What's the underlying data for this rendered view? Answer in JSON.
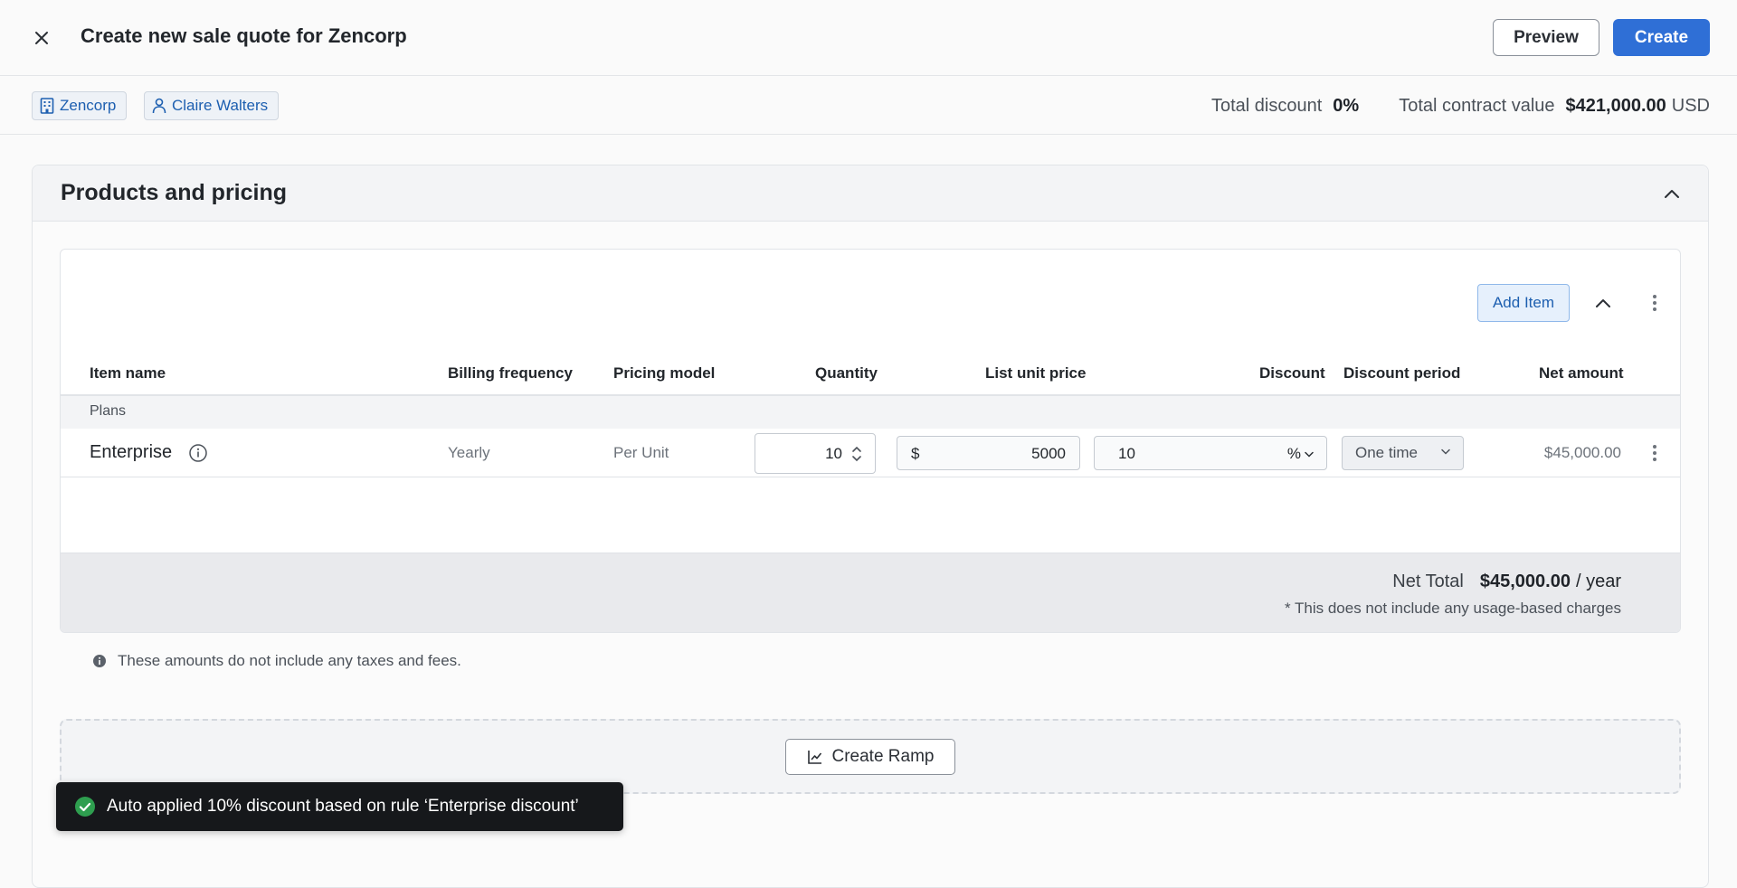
{
  "header": {
    "title": "Create new sale quote for Zencorp",
    "preview_label": "Preview",
    "create_label": "Create"
  },
  "subbar": {
    "company": "Zencorp",
    "contact": "Claire Walters",
    "total_discount_label": "Total discount",
    "total_discount_value": "0%",
    "total_contract_label": "Total contract value",
    "total_contract_value": "$421,000.00",
    "total_contract_currency": "USD"
  },
  "section": {
    "title": "Products and pricing"
  },
  "items": {
    "add_item_label": "Add Item",
    "columns": {
      "item_name": "Item name",
      "billing_frequency": "Billing frequency",
      "pricing_model": "Pricing model",
      "quantity": "Quantity",
      "list_unit_price": "List unit price",
      "discount": "Discount",
      "discount_period": "Discount period",
      "net_amount": "Net amount"
    },
    "group": "Plans",
    "rows": [
      {
        "name": "Enterprise",
        "billing_frequency": "Yearly",
        "pricing_model": "Per Unit",
        "quantity": "10",
        "currency_symbol": "$",
        "list_unit_price": "5000",
        "discount": "10",
        "discount_unit": "%",
        "discount_period": "One time",
        "net_amount": "$45,000.00"
      }
    ],
    "net_total_label": "Net Total",
    "net_total_value": "$45,000.00",
    "net_total_period": "/ year",
    "usage_note": "* This does not include any usage-based charges"
  },
  "tax_note": "These amounts do not include any taxes and fees.",
  "ramp": {
    "label": "Create Ramp"
  },
  "toast": {
    "message": "Auto applied 10% discount based on rule ‘Enterprise discount’"
  },
  "colors": {
    "primary": "#2f6fd6",
    "link": "#1d5fb0",
    "success": "#2e9e4f",
    "toast_bg": "#16181b"
  }
}
